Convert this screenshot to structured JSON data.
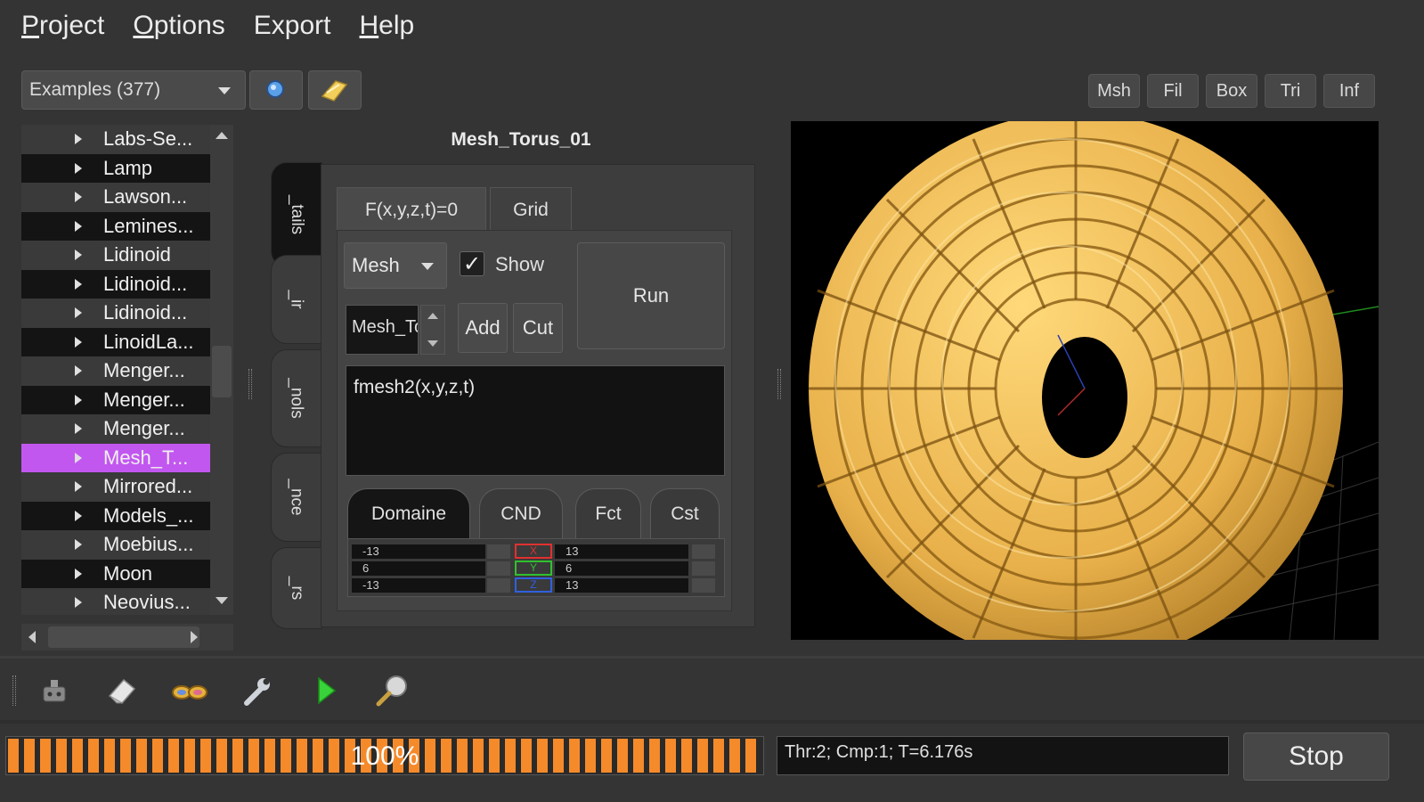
{
  "menu": {
    "project": "roject",
    "project_ul": "P",
    "options": "ptions",
    "options_ul": "O",
    "export": "Export",
    "help": "elp",
    "help_ul": "H"
  },
  "toolbar": {
    "examples_combo": "Examples (377)",
    "view_buttons": [
      "Msh",
      "Fil",
      "Box",
      "Tri",
      "Inf"
    ]
  },
  "example_list": {
    "items": [
      "Labs-Se...",
      "Lamp",
      "Lawson...",
      "Lemines...",
      "Lidinoid",
      "Lidinoid...",
      "Lidinoid...",
      "LinoidLa...",
      "Menger...",
      "Menger...",
      "Menger...",
      "Mesh_T...",
      "Mirrored...",
      "Models_...",
      "Moebius...",
      "Moon",
      "Neovius..."
    ],
    "selected_index": 11
  },
  "panel": {
    "title": "Mesh_Torus_01",
    "vertical_tabs": [
      "_tails",
      "_ir",
      "_nols",
      "_nce",
      "_rs"
    ],
    "tabs": [
      "F(x,y,z,t)=0",
      "Grid"
    ],
    "mesh_combo": "Mesh",
    "show_checked": true,
    "show_label": "Show",
    "run_label": "Run",
    "spin_value": "Mesh_Torus",
    "add_label": "Add",
    "cut_label": "Cut",
    "editor_text": "fmesh2(x,y,z,t)",
    "bottom_tabs": [
      "Domaine",
      "CND",
      "Fct",
      "Cst"
    ],
    "bounds": [
      "-13",
      "6",
      "-13"
    ],
    "bounds_right": [
      "13",
      "6",
      "13"
    ],
    "axis_labels": [
      "X",
      "Y",
      "Z"
    ]
  },
  "status": {
    "progress_percent": 100,
    "progress_text": "100%",
    "info_text": "Thr:2; Cmp:1; T=6.176s",
    "stop_label": "Stop"
  },
  "colors": {
    "selection": "#c257f0",
    "progress": "#f58a2b",
    "mesh": "#e8b04a"
  },
  "icons": [
    "search-icon",
    "folder-icon",
    "robot-icon",
    "eraser-icon",
    "glasses-icon",
    "wrench-icon",
    "play-icon",
    "zoom-icon"
  ]
}
